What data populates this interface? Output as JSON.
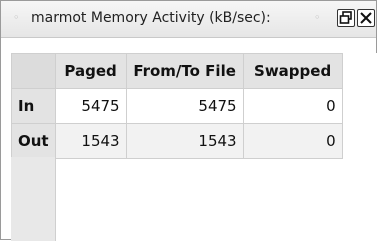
{
  "window": {
    "title": "marmot Memory Activity (kB/sec):",
    "left_glyph": "◦",
    "right_glyph": "◦"
  },
  "table": {
    "columns": [
      "Paged",
      "From/To File",
      "Swapped"
    ],
    "rows": [
      {
        "label": "In",
        "values": [
          "5475",
          "5475",
          "0"
        ]
      },
      {
        "label": "Out",
        "values": [
          "1543",
          "1543",
          "0"
        ]
      }
    ]
  },
  "icons": {
    "restore": "restore-icon",
    "close": "close-icon"
  }
}
